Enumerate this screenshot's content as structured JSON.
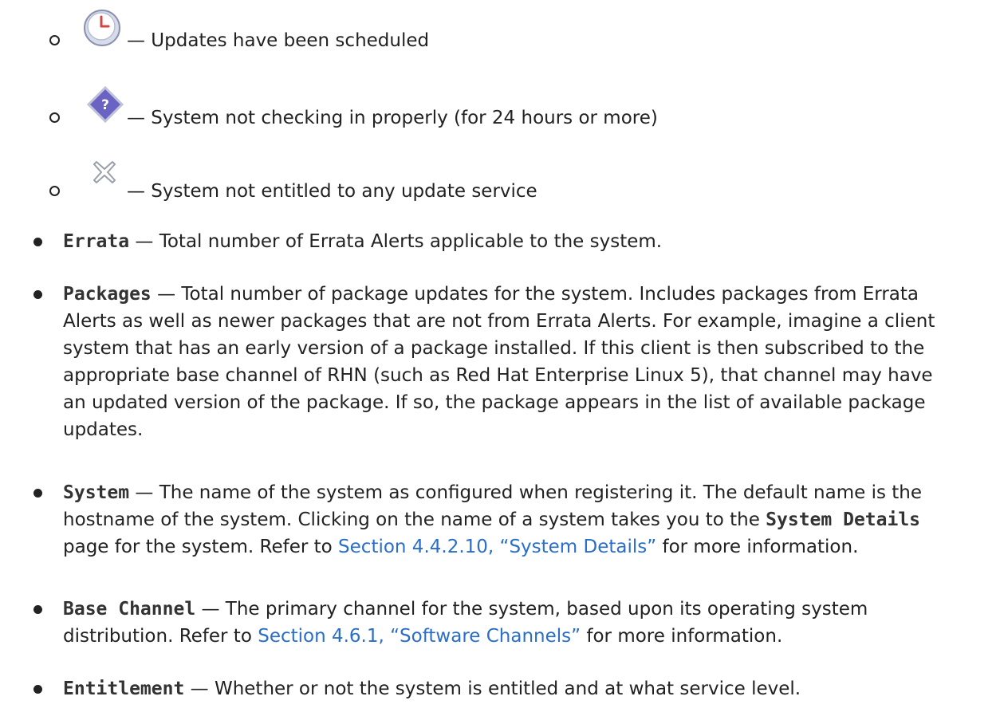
{
  "status_icons": [
    {
      "icon": "clock-icon",
      "text": "— Updates have been scheduled"
    },
    {
      "icon": "question-diamond-icon",
      "text": "— System not checking in properly (for 24 hours or more)"
    },
    {
      "icon": "cross-icon",
      "text": "— System not entitled to any update service"
    }
  ],
  "items": {
    "errata": {
      "term": "Errata",
      "text": "— Total number of Errata Alerts applicable to the system."
    },
    "packages": {
      "term": "Packages",
      "text": "— Total number of package updates for the system. Includes packages from Errata Alerts as well as newer packages that are not from Errata Alerts. For example, imagine a client system that has an early version of a package installed. If this client is then subscribed to the appropriate base channel of RHN (such as Red Hat Enterprise Linux 5), that channel may have an updated version of the package. If so, the package appears in the list of available package updates."
    },
    "system": {
      "term": "System",
      "text1": "— The name of the system as configured when registering it. The default name is the hostname of the system. Clicking on the name of a system takes you to the ",
      "mono": "System Details",
      "text2": " page for the system. Refer to ",
      "link": "Section 4.4.2.10, “System Details”",
      "text3": " for more information."
    },
    "base_channel": {
      "term": "Base Channel",
      "text1": "— The primary channel for the system, based upon its operating system distribution. Refer to ",
      "link": "Section 4.6.1, “Software Channels”",
      "text2": " for more information."
    },
    "entitlement": {
      "term": "Entitlement",
      "text": "— Whether or not the system is entitled and at what service level."
    }
  },
  "colors": {
    "link": "#2a6ec8",
    "text": "#222222"
  }
}
